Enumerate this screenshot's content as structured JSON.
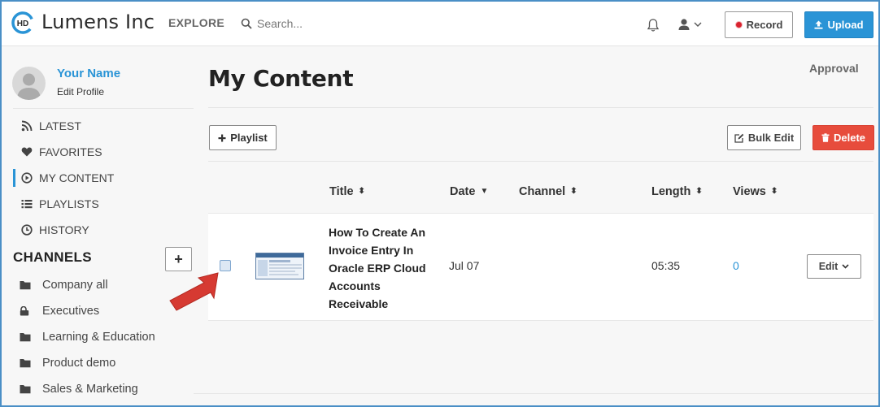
{
  "header": {
    "logo_badge": "HD",
    "app_name": "Lumens Inc",
    "explore": "EXPLORE",
    "search_placeholder": "Search...",
    "record_label": "Record",
    "upload_label": "Upload",
    "icons": [
      "search-icon",
      "bell-icon",
      "user-icon",
      "chevron-down-icon",
      "record-dot-icon",
      "upload-icon"
    ]
  },
  "sidebar": {
    "user_name": "Your Name",
    "edit_profile": "Edit Profile",
    "nav": [
      {
        "label": "LATEST",
        "icon": "rss-icon"
      },
      {
        "label": "FAVORITES",
        "icon": "heart-icon"
      },
      {
        "label": "MY CONTENT",
        "icon": "play-circle-icon",
        "active": true
      },
      {
        "label": "PLAYLISTS",
        "icon": "list-icon"
      },
      {
        "label": "HISTORY",
        "icon": "clock-icon"
      }
    ],
    "channels_title": "CHANNELS",
    "add_channel": "+",
    "channels": [
      {
        "label": "Company all",
        "icon": "folder-icon"
      },
      {
        "label": "Executives",
        "icon": "lock-icon"
      },
      {
        "label": "Learning & Education",
        "icon": "folder-icon"
      },
      {
        "label": "Product demo",
        "icon": "folder-icon"
      },
      {
        "label": "Sales & Marketing",
        "icon": "folder-icon"
      }
    ]
  },
  "main": {
    "title": "My Content",
    "approval": "Approval",
    "playlist_label": "Playlist",
    "bulk_edit_label": "Bulk Edit",
    "delete_label": "Delete",
    "columns": [
      "Title",
      "Date",
      "Channel",
      "Length",
      "Views"
    ],
    "rows": [
      {
        "title": "How To Create An Invoice Entry In Oracle ERP Cloud Accounts Receivable",
        "date": "Jul 07",
        "channel": "",
        "length": "05:35",
        "views": "0",
        "edit_label": "Edit",
        "checked": false
      }
    ]
  },
  "colors": {
    "accent": "#2a94d6",
    "delete": "#e74c3c",
    "record_dot": "#d9232f",
    "frame": "#4a8fc6",
    "annotation_arrow": "#d63a32"
  }
}
